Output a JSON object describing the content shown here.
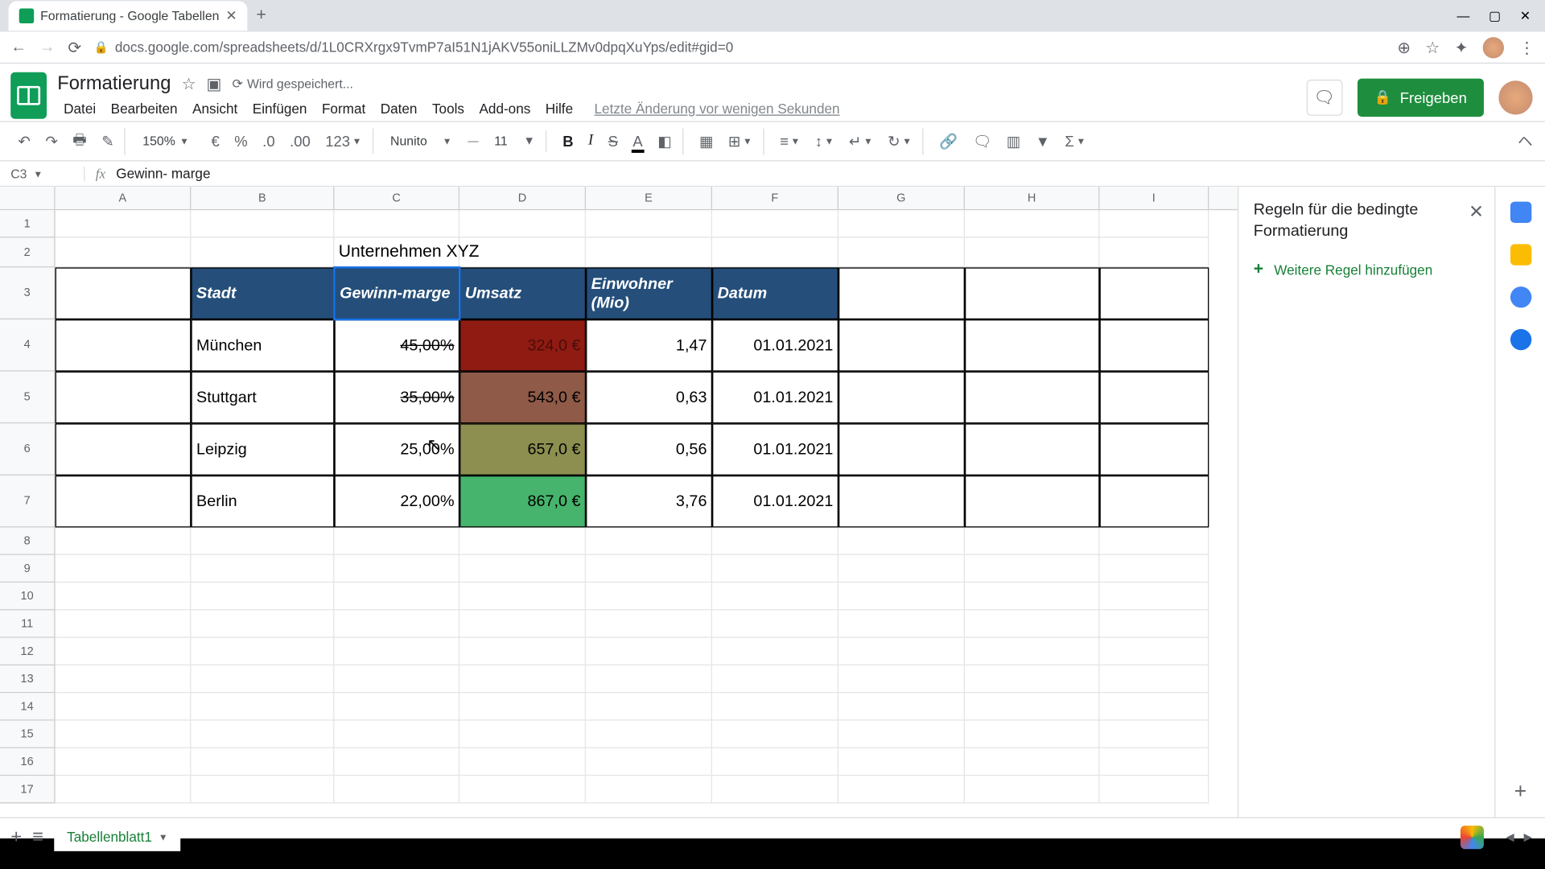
{
  "browser": {
    "tab_title": "Formatierung - Google Tabellen",
    "url": "docs.google.com/spreadsheets/d/1L0CRXrgx9TvmP7aI51N1jAKV55oniLLZMv0dpqXuYps/edit#gid=0"
  },
  "doc": {
    "title": "Formatierung",
    "save_status": "Wird gespeichert...",
    "last_edit": "Letzte Änderung vor wenigen Sekunden",
    "share_label": "Freigeben"
  },
  "menu": {
    "file": "Datei",
    "edit": "Bearbeiten",
    "view": "Ansicht",
    "insert": "Einfügen",
    "format": "Format",
    "data": "Daten",
    "tools": "Tools",
    "addons": "Add-ons",
    "help": "Hilfe"
  },
  "toolbar": {
    "zoom": "150%",
    "currency": "€",
    "percent": "%",
    "dec_less": ".0",
    "dec_more": ".00",
    "numfmt": "123",
    "font": "Nunito",
    "size": "11"
  },
  "formula": {
    "cell_ref": "C3",
    "value": "Gewinn- marge"
  },
  "columns": [
    "A",
    "B",
    "C",
    "D",
    "E",
    "F",
    "G",
    "H",
    "I"
  ],
  "rows": [
    "1",
    "2",
    "3",
    "4",
    "5",
    "6",
    "7",
    "8",
    "9",
    "10",
    "11",
    "12",
    "13",
    "14",
    "15",
    "16",
    "17"
  ],
  "table": {
    "title": "Unternehmen XYZ",
    "headers": {
      "stadt": "Stadt",
      "gewinn": "Gewinn-marge",
      "umsatz": "Umsatz",
      "einwohner": "Einwohner (Mio)",
      "datum": "Datum"
    },
    "rows": [
      {
        "stadt": "München",
        "gewinn": "45,00%",
        "gewinn_strike": true,
        "umsatz": "324,0 €",
        "umsatz_bg": "#8f1b13",
        "umsatz_fg": "#4a0d08",
        "einwohner": "1,47",
        "datum": "01.01.2021"
      },
      {
        "stadt": "Stuttgart",
        "gewinn": "35,00%",
        "gewinn_strike": true,
        "umsatz": "543,0 €",
        "umsatz_bg": "#8f5a48",
        "umsatz_fg": "#000",
        "einwohner": "0,63",
        "datum": "01.01.2021"
      },
      {
        "stadt": "Leipzig",
        "gewinn": "25,00%",
        "gewinn_strike": false,
        "umsatz": "657,0 €",
        "umsatz_bg": "#8c8f4f",
        "umsatz_fg": "#000",
        "einwohner": "0,56",
        "datum": "01.01.2021"
      },
      {
        "stadt": "Berlin",
        "gewinn": "22,00%",
        "gewinn_strike": false,
        "umsatz": "867,0 €",
        "umsatz_bg": "#46b46c",
        "umsatz_fg": "#000",
        "einwohner": "3,76",
        "datum": "01.01.2021"
      }
    ]
  },
  "sidepanel": {
    "title": "Regeln für die bedingte Formatierung",
    "add_rule": "Weitere Regel hinzufügen"
  },
  "sheets": {
    "active": "Tabellenblatt1"
  }
}
